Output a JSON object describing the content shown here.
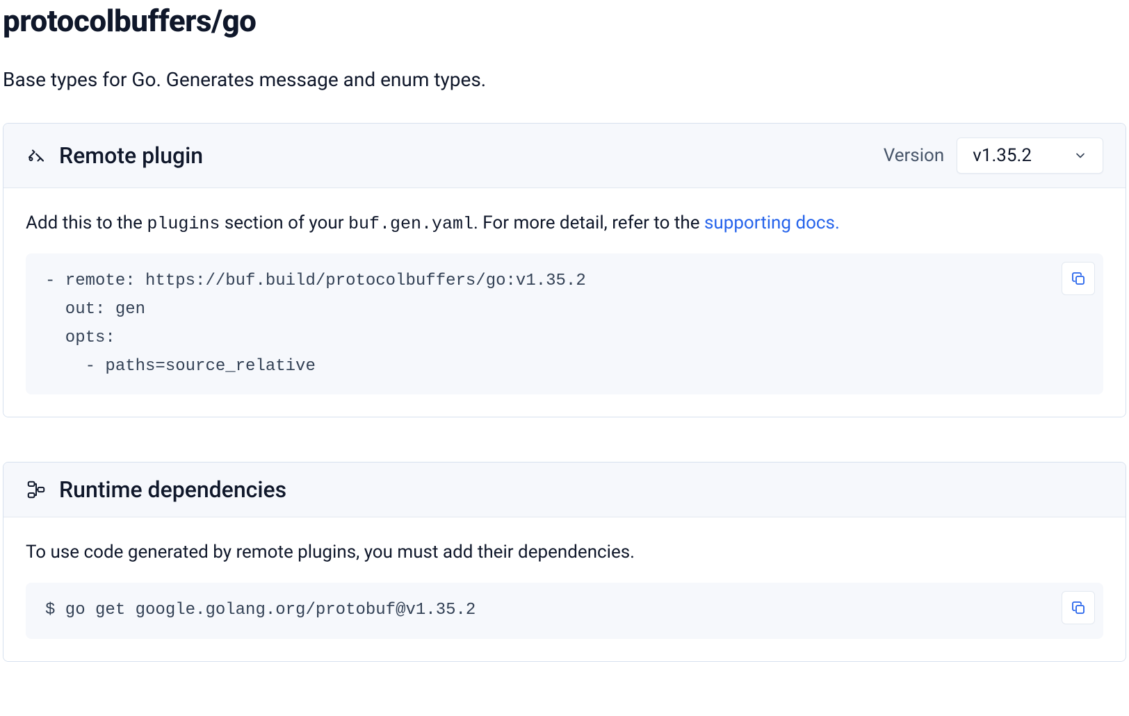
{
  "title": "protocolbuffers/go",
  "subtitle": "Base types for Go. Generates message and enum types.",
  "remote_plugin": {
    "heading": "Remote plugin",
    "version_label": "Version",
    "version_value": "v1.35.2",
    "desc_prefix": "Add this to the ",
    "desc_code1": "plugins",
    "desc_mid": " section of your ",
    "desc_code2": "buf.gen.yaml",
    "desc_after": ". For more detail, refer to the ",
    "desc_link": "supporting docs.",
    "code": "- remote: https://buf.build/protocolbuffers/go:v1.35.2\n  out: gen\n  opts:\n    - paths=source_relative"
  },
  "runtime_deps": {
    "heading": "Runtime dependencies",
    "desc": "To use code generated by remote plugins, you must add their dependencies.",
    "code": "$ go get google.golang.org/protobuf@v1.35.2"
  }
}
